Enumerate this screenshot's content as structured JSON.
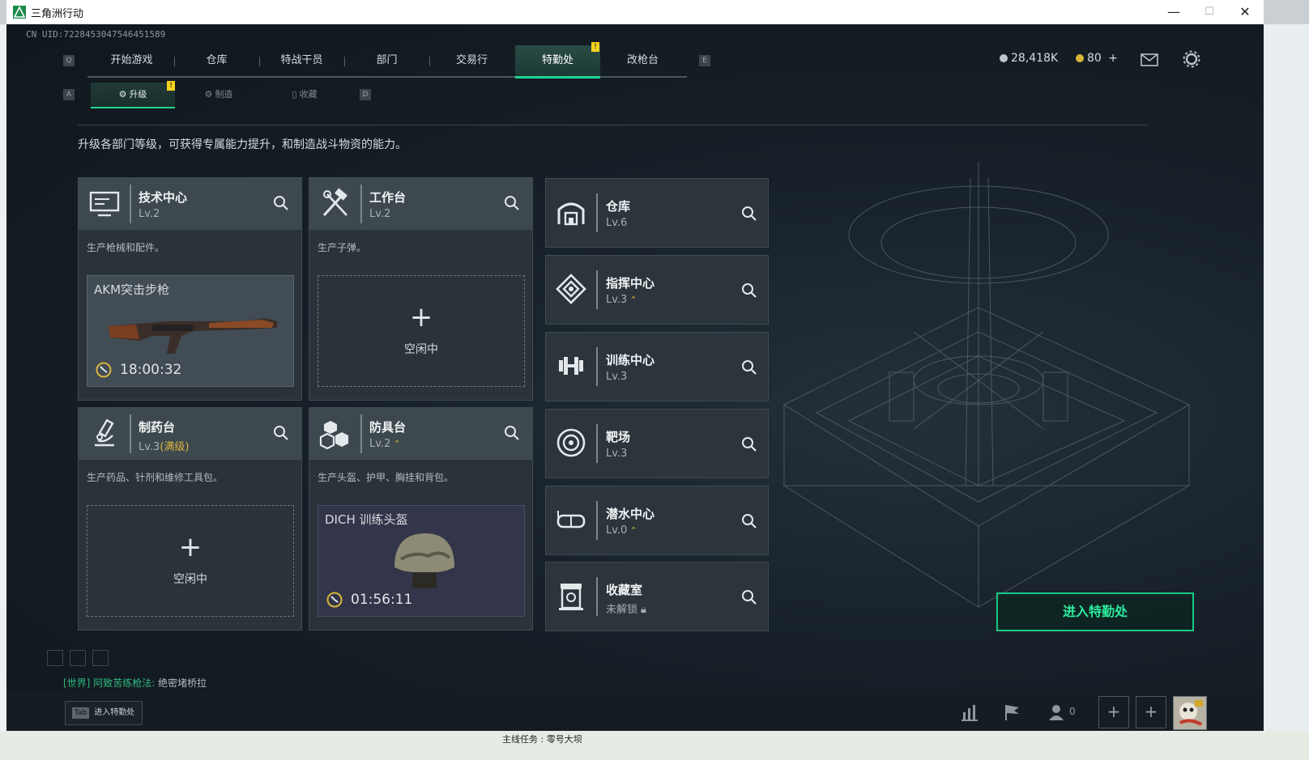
{
  "window": {
    "title": "三角洲行动",
    "minimize": "—",
    "maximize": "☐",
    "close": "✕"
  },
  "uid": "CN UID:7228453047546451589",
  "nav": {
    "left_key": "Q",
    "right_key": "E",
    "tabs": [
      {
        "label": "开始游戏"
      },
      {
        "label": "仓库"
      },
      {
        "label": "特战干员"
      },
      {
        "label": "部门"
      },
      {
        "label": "交易行"
      },
      {
        "label": "特勤处",
        "active": true,
        "badge": "!"
      },
      {
        "label": "改枪台"
      }
    ]
  },
  "subnav": {
    "left_key": "A",
    "right_key": "D",
    "tabs": [
      {
        "label": "升级",
        "active": true,
        "badge": "!"
      },
      {
        "label": "制造"
      },
      {
        "label": "收藏"
      }
    ]
  },
  "resources": {
    "currency": "28,418K",
    "coupons": "80",
    "add": "+"
  },
  "description": "升级各部门等级，可获得专属能力提升，和制造战斗物资的能力。",
  "production": [
    {
      "name": "技术中心",
      "level": "Lv.2",
      "icon": "computer-icon",
      "subtitle": "生产枪械和配件。",
      "slot": {
        "state": "busy",
        "item": "AKM突击步枪",
        "timer": "18:00:32"
      }
    },
    {
      "name": "工作台",
      "level": "Lv.2",
      "icon": "tools-icon",
      "subtitle": "生产子弹。",
      "slot": {
        "state": "idle",
        "plus": "+",
        "label": "空闲中"
      }
    },
    {
      "name": "制药台",
      "level": "Lv.3",
      "level_suffix": "(满级)",
      "icon": "microscope-icon",
      "subtitle": "生产药品、针剂和维修工具包。",
      "slot": {
        "state": "idle",
        "plus": "+",
        "label": "空闲中"
      }
    },
    {
      "name": "防具台",
      "level": "Lv.2",
      "upgradable": true,
      "icon": "armor-icon",
      "subtitle": "生产头盔、护甲、胸挂和背包。",
      "slot": {
        "state": "busy",
        "item": "DICH 训练头盔",
        "timer": "01:56:11"
      }
    }
  ],
  "facilities": [
    {
      "name": "仓库",
      "level": "Lv.6",
      "icon": "warehouse-icon"
    },
    {
      "name": "指挥中心",
      "level": "Lv.3",
      "upgradable": true,
      "icon": "command-icon"
    },
    {
      "name": "训练中心",
      "level": "Lv.3",
      "icon": "dumbbell-icon"
    },
    {
      "name": "靶场",
      "level": "Lv.3",
      "icon": "target-icon"
    },
    {
      "name": "潜水中心",
      "level": "Lv.0",
      "upgradable": true,
      "icon": "goggles-icon"
    },
    {
      "name": "收藏室",
      "level": "未解锁",
      "locked": true,
      "icon": "collection-icon"
    }
  ],
  "enter_button": "进入特勤处",
  "chat": {
    "channel": "[世界]",
    "sender": "阿致苦练枪法:",
    "message": "绝密堵桥拉"
  },
  "bottom": {
    "tab_key": "Tab",
    "tab_label": "进入特勤处",
    "friends_count": "0",
    "add1": "+",
    "add2": "+"
  },
  "taskbar_text": "主线任务 : 零号大坝"
}
